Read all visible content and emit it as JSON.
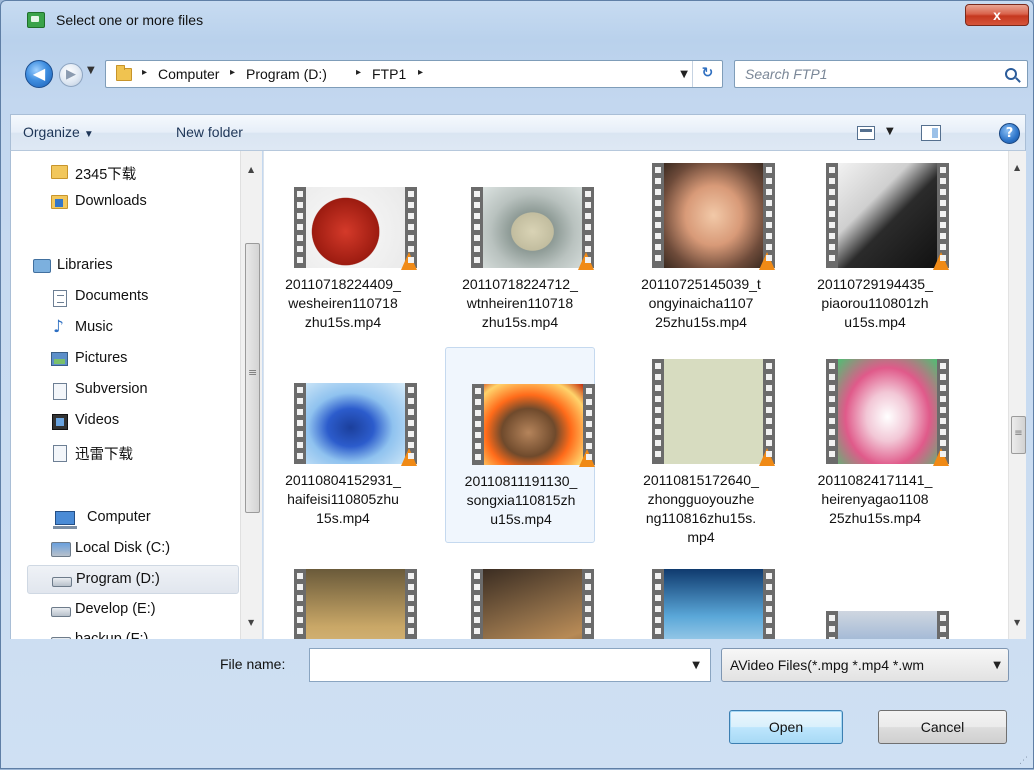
{
  "window": {
    "title": "Select one or more files",
    "close_label": "x"
  },
  "address": {
    "crumbs": [
      "Computer",
      "Program (D:)",
      "FTP1"
    ],
    "separator": "▸",
    "search_placeholder": "Search FTP1"
  },
  "toolbar": {
    "organize_label": "Organize",
    "new_folder_label": "New folder"
  },
  "nav": {
    "items": [
      {
        "label": "2345下载",
        "icon": "folder-icon"
      },
      {
        "label": "Downloads",
        "icon": "downloads-folder-icon"
      },
      {
        "label": "Libraries",
        "icon": "libraries-icon"
      },
      {
        "label": "Documents",
        "icon": "documents-icon"
      },
      {
        "label": "Music",
        "icon": "music-icon"
      },
      {
        "label": "Pictures",
        "icon": "pictures-icon"
      },
      {
        "label": "Subversion",
        "icon": "subversion-icon"
      },
      {
        "label": "Videos",
        "icon": "videos-icon"
      },
      {
        "label": "迅雷下载",
        "icon": "library-folder-icon"
      },
      {
        "label": "Computer",
        "icon": "computer-icon"
      },
      {
        "label": "Local Disk (C:)",
        "icon": "local-disk-icon"
      },
      {
        "label": "Program (D:)",
        "icon": "drive-icon"
      },
      {
        "label": "Develop (E:)",
        "icon": "drive-icon"
      },
      {
        "label": "backup (F:)",
        "icon": "drive-icon"
      }
    ],
    "selected": "Program (D:)"
  },
  "files": [
    {
      "name": "20110718224409_wesheiren110718zhu15s.mp4",
      "lines": [
        "20110718224409_",
        "wesheiren110718",
        "zhu15s.mp4"
      ],
      "thumb": "red-apple"
    },
    {
      "name": "20110718224712_wtnheiren110718zhu15s.mp4",
      "lines": [
        "20110718224712_",
        "wtnheiren110718",
        "zhu15s.mp4"
      ],
      "thumb": "cup-and-saucer"
    },
    {
      "name": "20110725145039_tongyinaicha110725zhu15s.mp4",
      "lines": [
        "20110725145039_t",
        "ongyinaicha1107",
        "25zhu15s.mp4"
      ],
      "thumb": "woman-with-glasses"
    },
    {
      "name": "20110729194435_piaorou110801zhu15s.mp4",
      "lines": [
        "20110729194435_",
        "piaorou110801zh",
        "u15s.mp4"
      ],
      "thumb": "hair-closeup"
    },
    {
      "name": "20110804152931_haifeisi110805zhu15s.mp4",
      "lines": [
        "20110804152931_",
        "haifeisi110805zhu",
        "15s.mp4"
      ],
      "thumb": "blue-jar-splash"
    },
    {
      "name": "20110811191130_songxia110815zhu15s.mp4",
      "lines": [
        "20110811191130_",
        "songxia110815zh",
        "u15s.mp4"
      ],
      "thumb": "fighter-with-fire"
    },
    {
      "name": "20110815172640_zhongguoyouzheng110816zhu15s.mp4",
      "lines": [
        "20110815172640_",
        "zhongguoyouzhe",
        "ng110816zhu15s.",
        "mp4"
      ],
      "thumb": "blank-green"
    },
    {
      "name": "20110824171141_heirenyagao110825zhu15s.mp4",
      "lines": [
        "20110824171141_",
        "heirenyagao1108",
        "25zhu15s.mp4"
      ],
      "thumb": "toothpaste-pink"
    },
    {
      "name": "",
      "lines": [],
      "thumb": "woman-in-coat"
    },
    {
      "name": "",
      "lines": [],
      "thumb": "brown-roof"
    },
    {
      "name": "",
      "lines": [],
      "thumb": "blue-logo"
    },
    {
      "name": "",
      "lines": [],
      "thumb": "store-interior"
    }
  ],
  "selected_file_index": 5,
  "bottom": {
    "file_name_label": "File name:",
    "file_name_value": "",
    "filter_label": "AVideo Files(*.mpg *.mp4 *.wm",
    "open_label": "Open",
    "cancel_label": "Cancel"
  }
}
